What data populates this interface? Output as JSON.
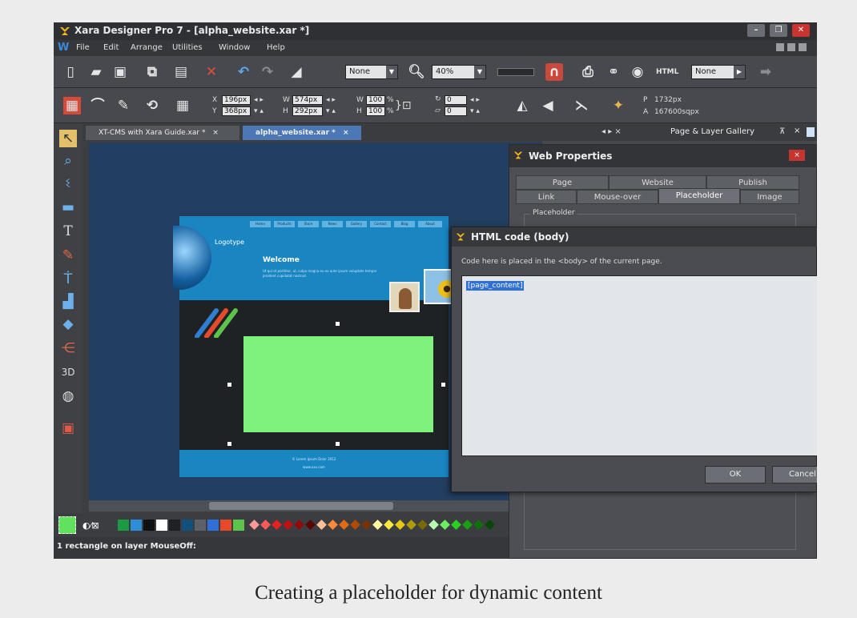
{
  "window": {
    "title": "Xara Designer Pro 7 - [alpha_website.xar *]"
  },
  "menu": {
    "items": [
      "File",
      "Edit",
      "Arrange",
      "Utilities",
      "Window",
      "Help"
    ]
  },
  "toolbar": {
    "quality_value": "None",
    "zoom_value": "40%",
    "style_value": "None"
  },
  "infobar": {
    "x_value": "196px",
    "y_value": "368px",
    "w_value": "574px",
    "h_value": "292px",
    "w_scale": "100",
    "h_scale": "100",
    "rotation": "0",
    "skew": "0",
    "perimeter": "1732px",
    "area": "167600sqpx",
    "x_label": "X",
    "y_label": "Y",
    "w_label": "W",
    "h_label": "H",
    "p_label": "P",
    "a_label": "A",
    "percent": "%"
  },
  "doc_tabs": [
    {
      "label": "XT-CMS with Xara Guide.xar *",
      "close": "×"
    },
    {
      "label": "alpha_website.xar *",
      "close": "×"
    }
  ],
  "gallery": {
    "title": "Page & Layer Gallery",
    "pin": "⊼",
    "close": "×"
  },
  "design": {
    "nav": [
      "Home",
      "Products",
      "Store",
      "News",
      "Gallery",
      "Contact",
      "Blog",
      "About"
    ],
    "logotype": "Logotype",
    "welcome": "Welcome",
    "body_text": "Ut qui et porttitor, ut, culpa magna eu ex aute ipsum voluptate tempor proident cupidatat nostrud.",
    "footer_line1": "© Lorem Ipsum Dolor 2012",
    "footer_line2": "www.xxx.com"
  },
  "status": {
    "text": "1 rectangle on layer MouseOff:"
  },
  "web_properties": {
    "title": "Web Properties",
    "close": "×",
    "tabs_top": [
      "Page",
      "Website",
      "Publish"
    ],
    "tabs_bottom": [
      "Link",
      "Mouse-over",
      "Placeholder",
      "Image"
    ],
    "active_tab": "Placeholder",
    "group_label": "Placeholder"
  },
  "html_dialog": {
    "title": "HTML code (body)",
    "description": "Code here is placed in the <body> of the current page.",
    "code": "[page_content]",
    "ok_label": "OK",
    "cancel_label": "Cancel"
  },
  "caption": "Creating a placeholder for dynamic content",
  "colors": {
    "canvas": "#223e60",
    "design_blue": "#1985c1",
    "placeholder_green": "#7ef27d",
    "selection": "#2f6fd8"
  }
}
